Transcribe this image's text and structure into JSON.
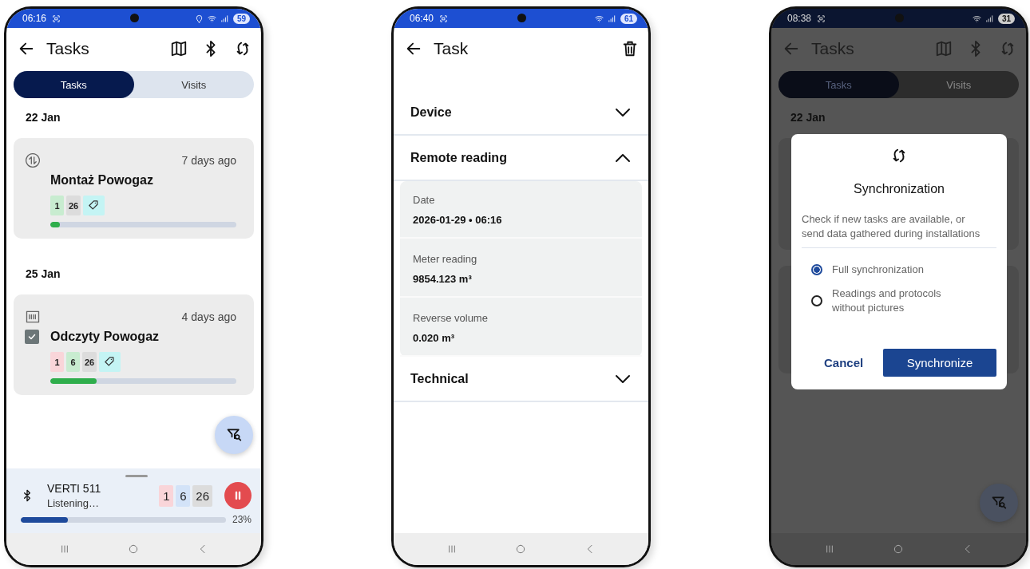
{
  "task_list_screen": {
    "status_bar": {
      "time": "06:16",
      "battery": "59"
    },
    "title": "Tasks",
    "tabs": [
      {
        "label": "Tasks",
        "selected": true
      },
      {
        "label": "Visits",
        "selected": false
      }
    ],
    "groups": [
      {
        "date": "22 Jan",
        "tasks": [
          {
            "kind": "install",
            "age": "7 days ago",
            "name": "Montaż Powogaz",
            "checked": false,
            "badges": [
              {
                "kind": "count",
                "value": "1",
                "color": "#c8ecd0"
              },
              {
                "kind": "count",
                "value": "26",
                "color": "#dcdcdc"
              },
              {
                "kind": "tag",
                "color": "#c4f4f4"
              }
            ],
            "level": 0.05
          }
        ]
      },
      {
        "date": "25 Jan",
        "tasks": [
          {
            "kind": "reading",
            "age": "4 days ago",
            "name": "Odczyty Powogaz",
            "checked": true,
            "badges": [
              {
                "kind": "count",
                "value": "1",
                "color": "#f9d5d9"
              },
              {
                "kind": "count",
                "value": "6",
                "color": "#c8ecd0"
              },
              {
                "kind": "count",
                "value": "26",
                "color": "#dcdcdc"
              },
              {
                "kind": "tag",
                "color": "#c4f4f4"
              }
            ],
            "level": 0.25
          }
        ]
      }
    ],
    "device_sheet": {
      "device": "VERTI 511",
      "status": "Listening…",
      "badges": [
        {
          "value": "1",
          "color": "#f9d5d9"
        },
        {
          "value": "6",
          "color": "#d3e3f8"
        },
        {
          "value": "26",
          "color": "#dcdcdc"
        }
      ],
      "level": 0.23,
      "percent": "23%"
    }
  },
  "task_detail_screen": {
    "status_bar": {
      "time": "06:40",
      "battery": "61"
    },
    "title": "Task",
    "sections": [
      {
        "title": "Device",
        "expanded": false
      },
      {
        "title": "Remote reading",
        "expanded": true,
        "fields": [
          {
            "label": "Date",
            "value": "2026-01-29 • 06:16"
          },
          {
            "label": "Meter reading",
            "value": "9854.123 m³"
          },
          {
            "label": "Reverse volume",
            "value": "0.020 m³"
          }
        ]
      },
      {
        "title": "Technical",
        "expanded": false
      }
    ]
  },
  "sync_screen": {
    "status_bar": {
      "time": "08:38",
      "battery": "31"
    },
    "title": "Tasks",
    "tabs": [
      {
        "label": "Tasks",
        "selected": true
      },
      {
        "label": "Visits",
        "selected": false
      }
    ],
    "date": "22 Jan",
    "dialog": {
      "title": "Synchronization",
      "description": "Check if new tasks are available, or send data gathered during installations",
      "options": [
        {
          "label": "Full synchronization",
          "selected": true
        },
        {
          "label": "Readings and protocols without pictures",
          "selected": false
        }
      ],
      "cancel": "Cancel",
      "confirm": "Synchronize"
    }
  }
}
